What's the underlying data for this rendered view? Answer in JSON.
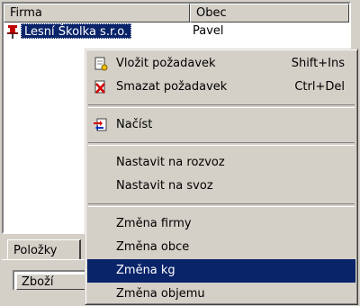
{
  "grid": {
    "columns": [
      "Firma",
      "Obec"
    ],
    "rows": [
      {
        "firma": "Lesní Školka s.r.o.",
        "obec": "Pavel"
      }
    ]
  },
  "tabs": [
    {
      "label": "Položky"
    }
  ],
  "subgrid": {
    "columns": [
      "Zboží"
    ]
  },
  "context_menu": {
    "items": [
      {
        "label": "Vložit požadavek",
        "shortcut": "Shift+Ins",
        "icon": "insert-document-icon"
      },
      {
        "label": "Smazat požadavek",
        "shortcut": "Ctrl+Del",
        "icon": "delete-document-icon"
      },
      {
        "label": "Načíst",
        "shortcut": "",
        "icon": "load-arrows-icon"
      },
      {
        "label": "Nastavit na rozvoz",
        "shortcut": ""
      },
      {
        "label": "Nastavit na svoz",
        "shortcut": ""
      },
      {
        "label": "Změna firmy",
        "shortcut": ""
      },
      {
        "label": "Změna obce",
        "shortcut": ""
      },
      {
        "label": "Změna kg",
        "shortcut": "",
        "highlighted": true
      },
      {
        "label": "Změna objemu",
        "shortcut": ""
      }
    ]
  },
  "colors": {
    "selection": "#0a246a",
    "face": "#d4d0c8"
  }
}
